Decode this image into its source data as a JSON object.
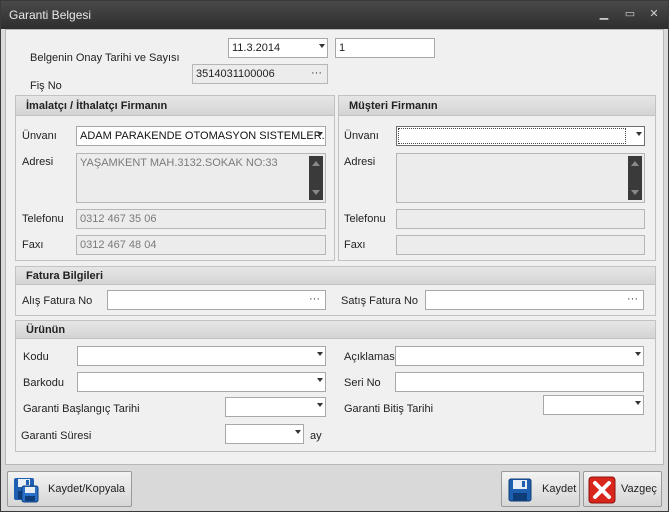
{
  "window": {
    "title": "Garanti Belgesi",
    "minimize_glyph": "▁",
    "maximize_glyph": "▭",
    "close_glyph": "✕"
  },
  "header": {
    "onay_label": "Belgenin Onay Tarihi ve Sayısı",
    "onay_date": "11.3.2014",
    "onay_number": "1",
    "fis_label": "Fiş No",
    "fis_value": "3514031100006"
  },
  "imalatci": {
    "title": "İmalatçı / İthalatçı Firmanın",
    "unvan_label": "Ünvanı",
    "unvan_value": "ADAM PARAKENDE OTOMASYON SISTEMLER...",
    "adres_label": "Adresi",
    "adres_value": "YAŞAMKENT MAH.3132.SOKAK NO:33",
    "telefon_label": "Telefonu",
    "telefon_value": "0312 467 35 06",
    "fax_label": "Faxı",
    "fax_value": "0312 467 48 04"
  },
  "musteri": {
    "title": "Müşteri Firmanın",
    "unvan_label": "Ünvanı",
    "unvan_value": "",
    "adres_label": "Adresi",
    "adres_value": "",
    "telefon_label": "Telefonu",
    "telefon_value": "",
    "fax_label": "Faxı",
    "fax_value": ""
  },
  "fatura": {
    "title": "Fatura Bilgileri",
    "alis_label": "Alış Fatura No",
    "alis_value": "",
    "satis_label": "Satış Fatura No",
    "satis_value": ""
  },
  "urun": {
    "title": "Ürünün",
    "kodu_label": "Kodu",
    "kodu_value": "",
    "aciklama_label": "Açıklaması",
    "aciklama_value": "",
    "barkod_label": "Barkodu",
    "barkod_value": "",
    "seri_label": "Seri No",
    "seri_value": "",
    "baslangic_label": "Garanti Başlangıç Tarihi",
    "baslangic_value": "",
    "bitis_label": "Garanti Bitiş Tarihi",
    "bitis_value": "",
    "sure_label": "Garanti Süresi",
    "sure_value": "",
    "sure_unit": "ay"
  },
  "buttons": {
    "kaydet_kopyala": "Kaydet/Kopyala",
    "kaydet": "Kaydet",
    "vazgec": "Vazgeç"
  },
  "ellipsis": "···",
  "colors": {
    "titlebar": "#2e2e2e",
    "cancel_red": "#d9261c",
    "save_blue": "#1f5fb0"
  }
}
